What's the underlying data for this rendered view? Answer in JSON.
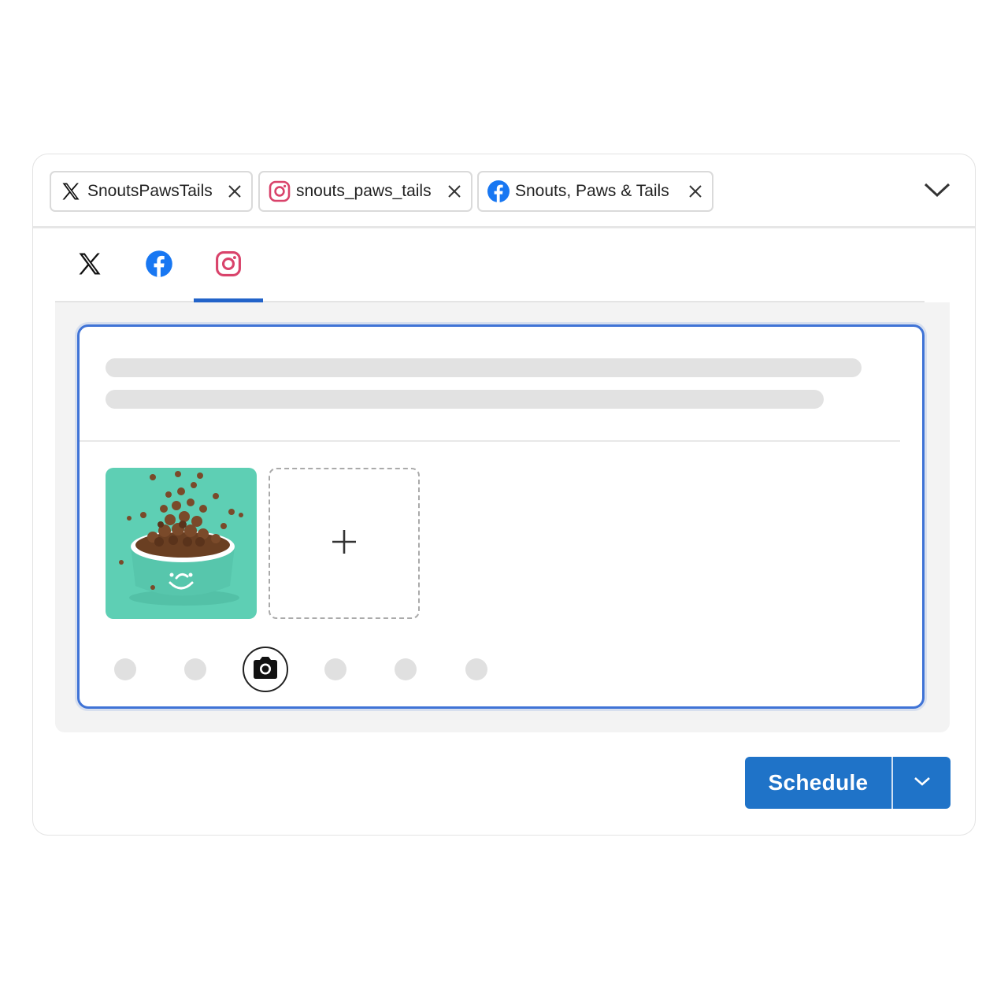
{
  "accounts": [
    {
      "platform": "x",
      "name": "SnoutsPawsTails",
      "icon": "x-logo-icon"
    },
    {
      "platform": "instagram",
      "name": "snouts_paws_tails",
      "icon": "instagram-logo-icon"
    },
    {
      "platform": "facebook",
      "name": "Snouts, Paws & Tails",
      "icon": "facebook-logo-icon"
    }
  ],
  "tabs": [
    {
      "platform": "x",
      "icon": "x-logo-icon",
      "active": false
    },
    {
      "platform": "facebook",
      "icon": "facebook-logo-icon",
      "active": false
    },
    {
      "platform": "instagram",
      "icon": "instagram-logo-icon",
      "active": true
    }
  ],
  "editor": {
    "media": [
      {
        "description_icon": "pet-food-bowl-image"
      }
    ],
    "add_media_icon": "plus-icon",
    "toolbar_icons": [
      "placeholder-tool",
      "placeholder-tool",
      "camera-icon",
      "placeholder-tool",
      "placeholder-tool",
      "placeholder-tool"
    ]
  },
  "actions": {
    "schedule_label": "Schedule",
    "schedule_menu_icon": "chevron-down-icon"
  },
  "colors": {
    "accent": "#1f73c8",
    "editor_border": "#3f73d6",
    "instagram": "#d9436b",
    "facebook": "#1877f2",
    "food_bowl": "#5ecfb4"
  }
}
